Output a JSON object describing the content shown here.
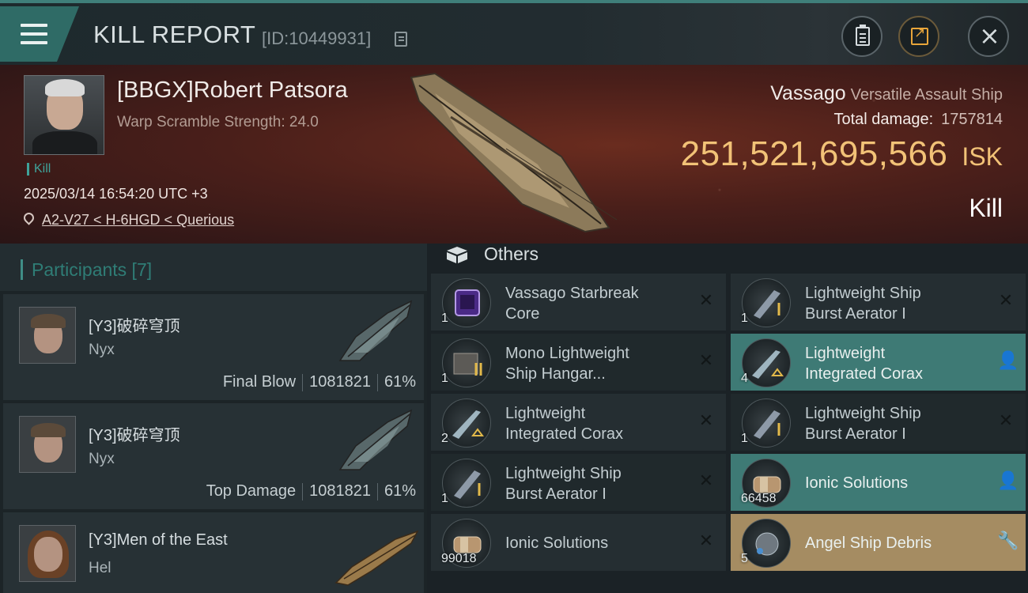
{
  "header": {
    "title": "KILL REPORT",
    "report_id": "[ID:10449931]",
    "icons": {
      "menu": "menu-icon",
      "copy": "copy-icon",
      "report": "clipboard-icon",
      "share": "share-icon",
      "close": "close-icon"
    }
  },
  "victim": {
    "name": "[BBGX]Robert Patsora",
    "scramble": "Warp Scramble Strength: 24.0",
    "tag": "Kill",
    "datetime": "2025/03/14 16:54:20 UTC +3",
    "location": "A2-V27 < H-6HGD < Querious",
    "ship_name": "Vassago",
    "ship_type": "Versatile Assault Ship",
    "total_damage_label": "Total damage:",
    "total_damage": "1757814",
    "isk_value": "251,521,695,566",
    "isk_unit": "ISK",
    "result": "Kill"
  },
  "participants": {
    "title": "Participants [7]",
    "items": [
      {
        "name": "[Y3]破碎穹顶",
        "ship": "Nyx",
        "role": "Final Blow",
        "damage": "1081821",
        "percent": "61%"
      },
      {
        "name": "[Y3]破碎穹顶",
        "ship": "Nyx",
        "role": "Top Damage",
        "damage": "1081821",
        "percent": "61%"
      },
      {
        "name": "[Y3]Men of the East",
        "ship": "Hel",
        "role": "",
        "damage": "",
        "percent": ""
      }
    ]
  },
  "others": {
    "title": "Others",
    "items": [
      {
        "name_line1": "Vassago Starbreak",
        "name_line2": "Core",
        "qty": "1",
        "status": "destroyed",
        "status_glyph": "✕"
      },
      {
        "name_line1": "Lightweight Ship",
        "name_line2": "Burst Aerator I",
        "qty": "1",
        "status": "destroyed",
        "status_glyph": "✕"
      },
      {
        "name_line1": "Mono Lightweight",
        "name_line2": "Ship Hangar...",
        "qty": "1",
        "status": "destroyed",
        "status_glyph": "✕"
      },
      {
        "name_line1": "Lightweight",
        "name_line2": "Integrated Corax",
        "qty": "4",
        "status": "dropped",
        "status_glyph": "👤"
      },
      {
        "name_line1": "Lightweight",
        "name_line2": "Integrated Corax",
        "qty": "2",
        "status": "destroyed",
        "status_glyph": "✕"
      },
      {
        "name_line1": "Lightweight Ship",
        "name_line2": "Burst Aerator I",
        "qty": "1",
        "status": "destroyed",
        "status_glyph": "✕"
      },
      {
        "name_line1": "Lightweight Ship",
        "name_line2": "Burst Aerator I",
        "qty": "1",
        "status": "destroyed",
        "status_glyph": "✕"
      },
      {
        "name_line1": "Ionic Solutions",
        "name_line2": "",
        "qty": "66458",
        "status": "dropped",
        "status_glyph": "👤"
      },
      {
        "name_line1": "Ionic Solutions",
        "name_line2": "",
        "qty": "99018",
        "status": "destroyed",
        "status_glyph": "✕"
      },
      {
        "name_line1": "Angel Ship Debris",
        "name_line2": "",
        "qty": "5",
        "status": "salvage",
        "status_glyph": "🔧"
      }
    ]
  },
  "colors": {
    "accent_teal": "#3e7a75",
    "isk_gold": "#f2c277",
    "salvage_gold": "#a58c62"
  }
}
